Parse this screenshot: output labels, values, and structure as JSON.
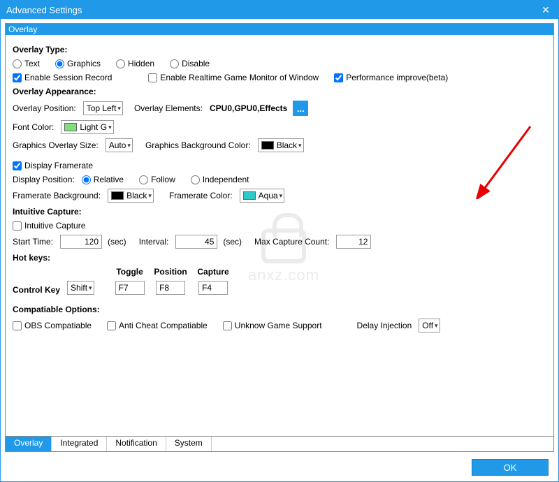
{
  "window_title": "Advanced Settings",
  "panel_title": "Overlay",
  "overlay_type": {
    "title": "Overlay Type:",
    "options": [
      "Text",
      "Graphics",
      "Hidden",
      "Disable"
    ],
    "selected": "Graphics",
    "enable_session": "Enable Session Record",
    "enable_session_checked": true,
    "enable_realtime": "Enable Realtime Game Monitor of Window",
    "enable_realtime_checked": false,
    "perf_improve": "Performance improve(beta)",
    "perf_improve_checked": true
  },
  "appearance": {
    "title": "Overlay Appearance:",
    "position_label": "Overlay Position:",
    "position_value": "Top Left",
    "elements_label": "Overlay Elements:",
    "elements_value": "CPU0,GPU0,Effects",
    "font_color_label": "Font Color:",
    "font_color_value": "Light G",
    "font_color_swatch": "#7de07a",
    "gsize_label": "Graphics Overlay Size:",
    "gsize_value": "Auto",
    "gbg_label": "Graphics Background Color:",
    "gbg_value": "Black",
    "gbg_swatch": "#000000"
  },
  "framerate": {
    "display_label": "Display Framerate",
    "display_checked": true,
    "position_label": "Display Position:",
    "position_options": [
      "Relative",
      "Follow",
      "Independent"
    ],
    "position_selected": "Relative",
    "bg_label": "Framerate Background:",
    "bg_value": "Black",
    "bg_swatch": "#000000",
    "color_label": "Framerate Color:",
    "color_value": "Aqua",
    "color_swatch": "#2fc9c9"
  },
  "capture": {
    "title": "Intuitive Capture:",
    "enable_label": "Intuitive Capture",
    "enable_checked": false,
    "start_label": "Start Time:",
    "start_value": "120",
    "start_unit": "(sec)",
    "interval_label": "Interval:",
    "interval_value": "45",
    "interval_unit": "(sec)",
    "max_label": "Max Capture Count:",
    "max_value": "12"
  },
  "hotkeys": {
    "title": "Hot keys:",
    "control_label": "Control Key",
    "control_value": "Shift",
    "cols": [
      "Toggle",
      "Position",
      "Capture"
    ],
    "toggle": "F7",
    "position": "F8",
    "capture": "F4"
  },
  "compat": {
    "title": "Compatiable Options:",
    "obs": "OBS Compatiable",
    "obs_checked": false,
    "anticheat": "Anti Cheat Compatiable",
    "anticheat_checked": false,
    "unknown": "Unknow Game Support",
    "unknown_checked": false,
    "delay_label": "Delay Injection",
    "delay_value": "Off"
  },
  "tabs": [
    "Overlay",
    "Integrated",
    "Notification",
    "System"
  ],
  "active_tab": "Overlay",
  "ok_label": "OK",
  "watermark_text": "anxz.com",
  "ellipsis": "..."
}
